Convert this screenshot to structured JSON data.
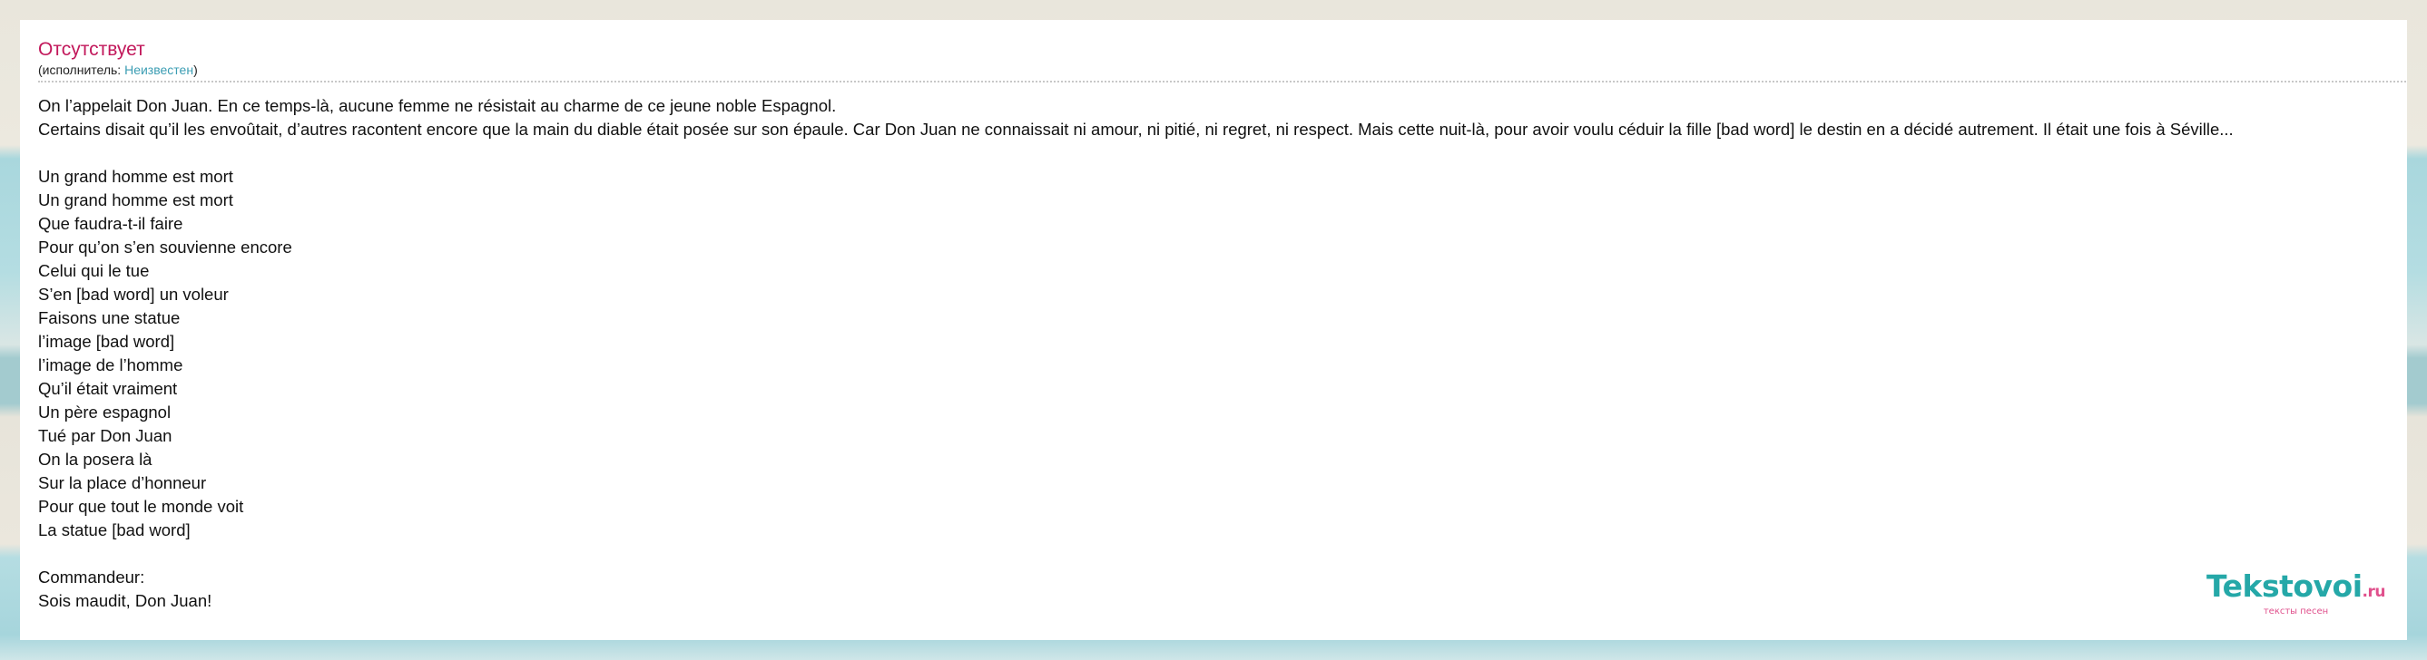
{
  "song": {
    "title": "Отсутствует",
    "performer_prefix": "(исполнитель: ",
    "performer_name": "Неизвестен",
    "performer_suffix": ")"
  },
  "lyrics": [
    "On l’appelait Don Juan. En ce temps-là, aucune femme ne résistait au charme de ce jeune noble Espagnol.",
    "Certains disait qu’il les envoûtait, d’autres racontent encore que la main du diable était posée sur son épaule. Car Don Juan ne connaissait ni amour, ni pitié, ni regret, ni respect. Mais cette nuit-là, pour avoir voulu céduir la fille [bad word]  le destin en a décidé autrement. Il était une fois à Séville...",
    "",
    "Un grand homme est mort",
    "Un grand homme est mort",
    "Que faudra-t-il faire",
    "Pour qu’on s’en souvienne encore",
    "Celui qui le tue",
    "S’en [bad word] un voleur",
    "Faisons une statue",
    "l’image [bad word]",
    "l’image de l’homme",
    "Qu’il était vraiment",
    "Un père espagnol",
    "Tué par Don Juan",
    "On la posera là",
    "Sur la place d’honneur",
    "Pour que tout le monde voit",
    "La statue [bad word]",
    "",
    "Commandeur:",
    "Sois maudit, Don Juan!"
  ],
  "logo": {
    "brand": "Tekstovoi",
    "tld": ".ru",
    "tagline": "тексты песен"
  }
}
